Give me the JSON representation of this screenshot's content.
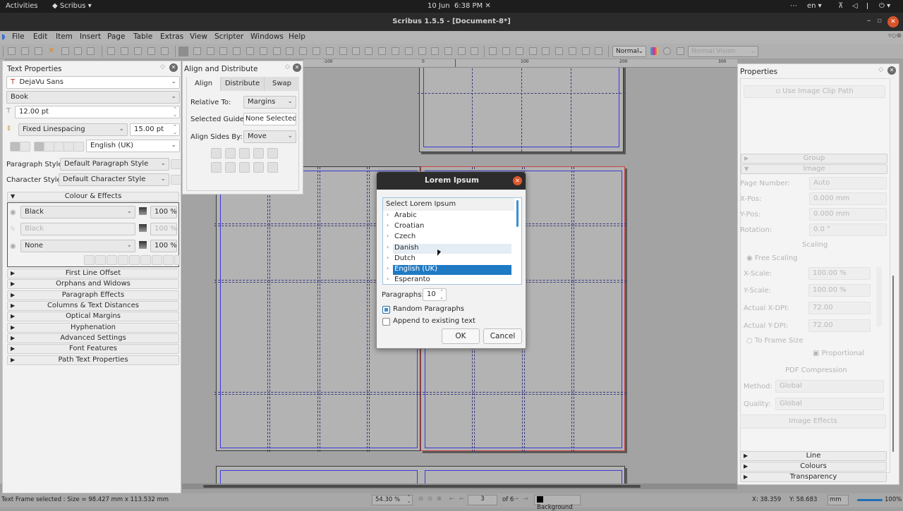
{
  "system_bar": {
    "activities": "Activities",
    "app_name": "Scribus",
    "date": "10 Jun",
    "time": "6:38 PM",
    "keyboard_layout": "en",
    "tray_icons": [
      "more-icon",
      "network-icon",
      "volume-icon",
      "microphone-icon",
      "power-icon"
    ]
  },
  "window": {
    "title": "Scribus 1.5.5 - [Document-8*]"
  },
  "menubar": [
    "File",
    "Edit",
    "Item",
    "Insert",
    "Page",
    "Table",
    "Extras",
    "View",
    "Scripter",
    "Windows",
    "Help"
  ],
  "toolbar": {
    "render_mode": "Normal",
    "vision_mode": "Normal Vision"
  },
  "ruler": {
    "ticks": [
      "-100",
      "0",
      "100",
      "200",
      "300"
    ]
  },
  "text_properties": {
    "title": "Text Properties",
    "font": "DejaVu Sans",
    "style": "Book",
    "size": "12.00 pt",
    "linespacing_mode": "Fixed Linespacing",
    "linespacing_value": "15.00 pt",
    "language": "English (UK)",
    "paragraph_style_label": "Paragraph Style:",
    "paragraph_style": "Default Paragraph Style",
    "character_style_label": "Character Style:",
    "character_style": "Default Character Style",
    "colour_section": "Colour & Effects",
    "fill_color": "Black",
    "fill_shade": "100 %",
    "stroke_color": "Black",
    "stroke_shade": "100 %",
    "background_color": "None",
    "background_shade": "100 %",
    "sections": [
      "First Line Offset",
      "Orphans and Widows",
      "Paragraph Effects",
      "Columns & Text Distances",
      "Optical Margins",
      "Hyphenation",
      "Advanced Settings",
      "Font Features",
      "Path Text Properties"
    ]
  },
  "align_distribute": {
    "title": "Align and Distribute",
    "tabs": [
      "Align",
      "Distribute",
      "Swap"
    ],
    "active_tab": "Align",
    "relative_to_label": "Relative To:",
    "relative_to": "Margins",
    "selected_guide_label": "Selected Guide:",
    "selected_guide": "None Selected",
    "align_sides_label": "Align Sides By:",
    "align_sides": "Move"
  },
  "lorem_dialog": {
    "title": "Lorem Ipsum",
    "tree_header": "Select Lorem Ipsum",
    "languages": [
      "Arabic",
      "Croatian",
      "Czech",
      "Danish",
      "Dutch",
      "English (UK)",
      "Esperanto"
    ],
    "hovered": "Danish",
    "selected": "English (UK)",
    "paragraphs_label": "Paragraphs:",
    "paragraphs": "10",
    "random_label": "Random Paragraphs",
    "random_checked": true,
    "append_label": "Append to existing text",
    "append_checked": false,
    "ok": "OK",
    "cancel": "Cancel"
  },
  "properties": {
    "title": "Properties",
    "clip_path": "Use Image Clip Path",
    "group_section": "Group",
    "image_section": "Image",
    "page_number_label": "Page Number:",
    "page_number": "Auto",
    "xpos_label": "X-Pos:",
    "xpos": "0.000 mm",
    "ypos_label": "Y-Pos:",
    "ypos": "0.000 mm",
    "rotation_label": "Rotation:",
    "rotation": "0.0 °",
    "scaling": "Scaling",
    "free_scaling": "Free Scaling",
    "xscale_label": "X-Scale:",
    "xscale": "100.00 %",
    "yscale_label": "Y-Scale:",
    "yscale": "100.00 %",
    "xdpi_label": "Actual X-DPI:",
    "xdpi": "72.00",
    "ydpi_label": "Actual Y-DPI:",
    "ydpi": "72.00",
    "to_frame_size": "To Frame Size",
    "proportional": "Proportional",
    "pdf_compression": "PDF Compression",
    "method_label": "Method:",
    "method": "Global",
    "quality_label": "Quality:",
    "quality": "Global",
    "image_effects": "Image Effects",
    "bottom_sections": [
      "Line",
      "Colours",
      "Transparency"
    ]
  },
  "statusbar": {
    "message": "Text Frame selected : Size = 98.427 mm x 113.532 mm",
    "zoom": "54.30 %",
    "current_page": "3",
    "page_count": "of 6",
    "layer": "Background",
    "x_label": "X:",
    "x": "38.359",
    "y_label": "Y:",
    "y": "58.683",
    "unit": "mm",
    "zoom_slider": "100%"
  }
}
